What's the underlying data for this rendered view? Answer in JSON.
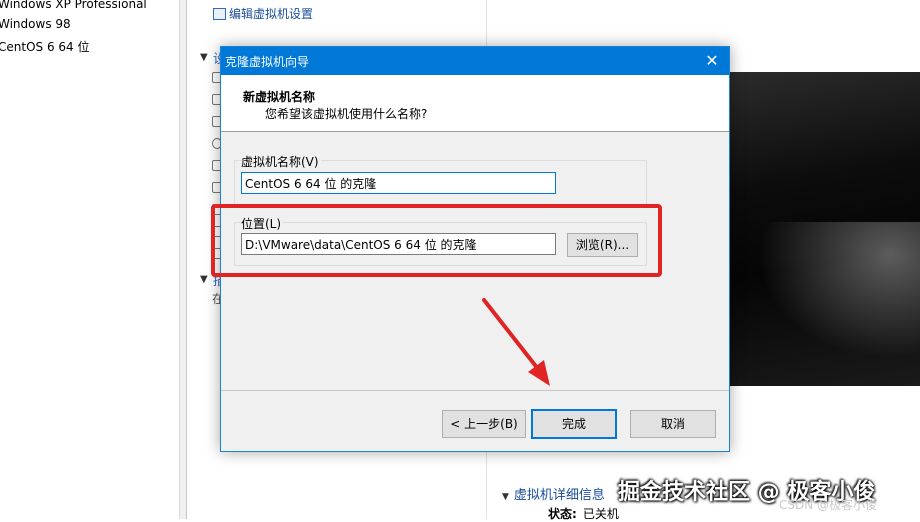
{
  "library": {
    "items": [
      "Windows XP Professional",
      "Windows 98",
      "CentOS 6 64 位"
    ]
  },
  "vm_panel": {
    "edit_settings_link": "编辑虚拟机设置",
    "devices_section_fragment": "设",
    "desc_section_fragment": "描",
    "desc_text_fragment": "在"
  },
  "details": {
    "title": "虚拟机详细信息",
    "status_label": "状态:",
    "status_value": "已关机"
  },
  "watermarks": {
    "main": "掘金技术社区 @ 极客小俊",
    "csdn": "CSDN @极客小俊"
  },
  "dialog": {
    "title": "克隆虚拟机向导",
    "header_title": "新虚拟机名称",
    "header_subtitle": "您希望该虚拟机使用什么名称?",
    "name_group_label": "虚拟机名称(V)",
    "name_value": "CentOS 6 64 位 的克隆",
    "location_group_label": "位置(L)",
    "location_value": "D:\\VMware\\data\\CentOS 6 64 位 的克隆",
    "browse_label": "浏览(R)...",
    "back_label": "< 上一步(B)",
    "finish_label": "完成",
    "cancel_label": "取消",
    "close_glyph": "✕"
  },
  "annotation": {
    "highlight_color": "#e02424"
  },
  "colors": {
    "title_bar": "#0078d7",
    "link": "#1a4d99"
  }
}
